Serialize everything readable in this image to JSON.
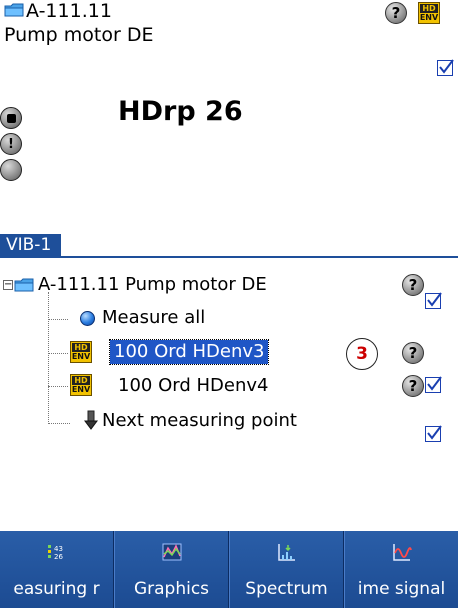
{
  "header": {
    "point_id": "A-111.11",
    "point_name": "Pump motor DE",
    "reading": "HDrp 26"
  },
  "section_tab": "VIB-1",
  "tree": {
    "root_label": "A-111.11 Pump motor DE",
    "items": [
      {
        "label": "Measure all"
      },
      {
        "label": "100 Ord HDenv3",
        "selected": true
      },
      {
        "label": "100 Ord HDenv4"
      },
      {
        "label": "Next measuring point"
      }
    ]
  },
  "callout_number": "3",
  "icons": {
    "hd_badge_top": "HD",
    "hd_badge_bottom": "ENV",
    "help_glyph": "?",
    "warning_glyph": "!"
  },
  "toolbar": {
    "buttons": [
      {
        "label": "easuring r"
      },
      {
        "label": "Graphics"
      },
      {
        "label": "Spectrum"
      },
      {
        "label": "ime signal"
      }
    ]
  },
  "colors": {
    "accent_blue": "#1e4f9a",
    "selection_blue": "#1f56c6",
    "hd_yellow": "#f2c200",
    "callout_red": "#cc0000"
  }
}
